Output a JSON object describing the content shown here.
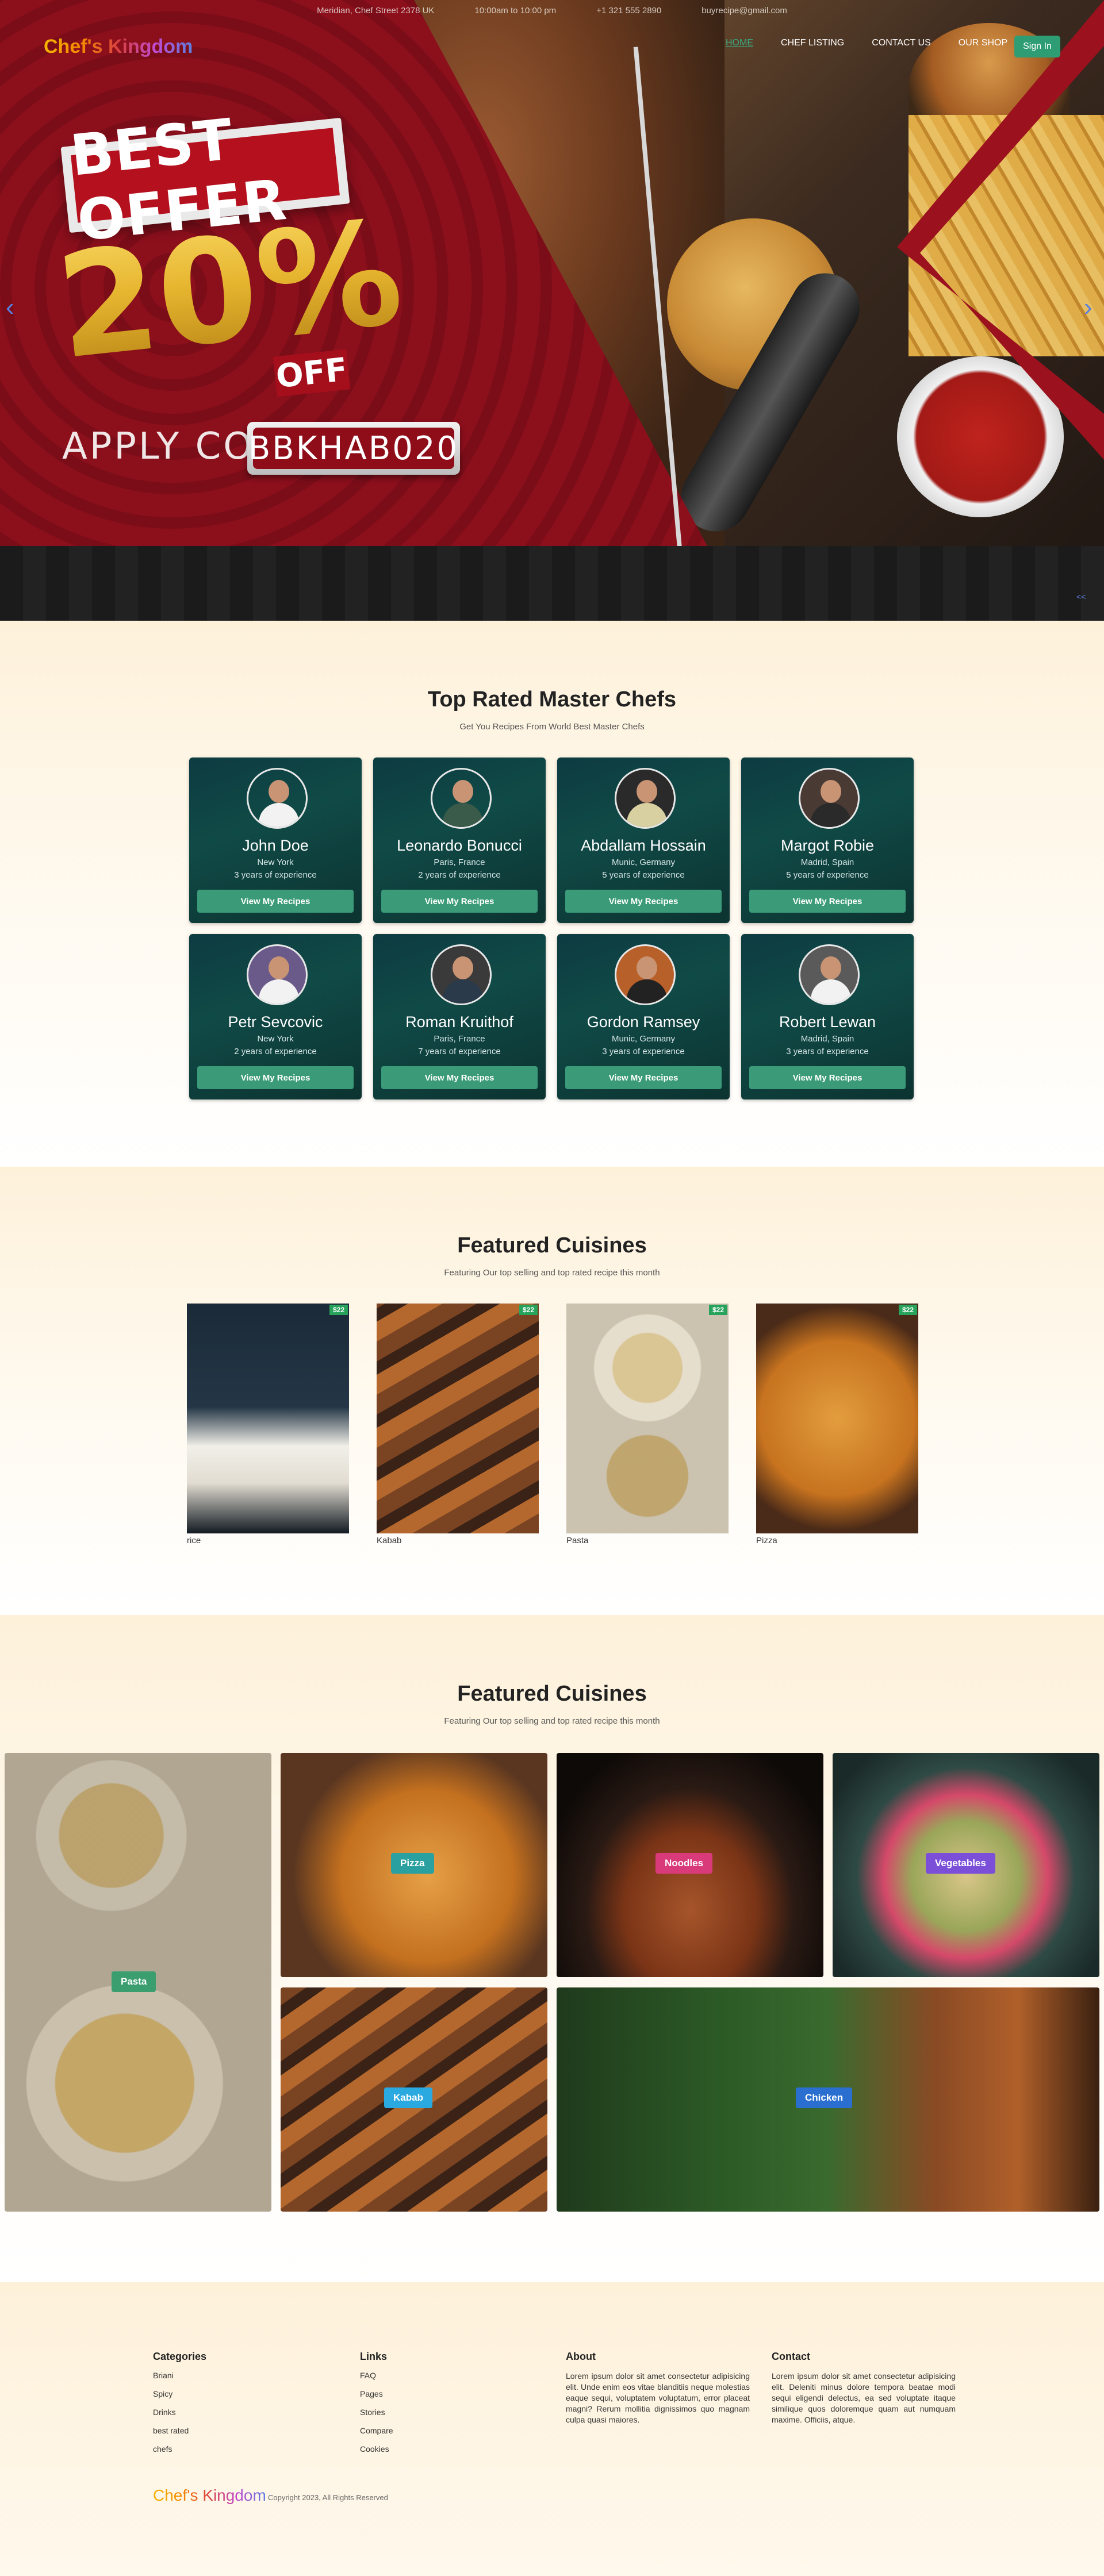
{
  "topbar": {
    "address": "Meridian, Chef Street 2378 UK",
    "hours": "10:00am to 10:00 pm",
    "phone": "+1 321 555 2890",
    "email": "buyrecipe@gmail.com"
  },
  "brand": "Chef's Kingdom",
  "nav": [
    "HOME",
    "CHEF LISTING",
    "CONTACT US",
    "OUR SHOP"
  ],
  "signin": "Sign In",
  "hero": {
    "offer_line": "BEST OFFER",
    "percent": "20%",
    "off": "OFF",
    "apply": "APPLY CODE",
    "code": "BBKHAB020",
    "arrow_left": "‹",
    "arrow_right": "›",
    "dot": "<<",
    "colors": {
      "red": "#8c0f1c",
      "gold": "#e6b52f"
    }
  },
  "chefs_section": {
    "title": "Top Rated Master Chefs",
    "subtitle": "Get You Recipes From World Best Master Chefs",
    "button_label": "View My Recipes",
    "chefs": [
      {
        "name": "John Doe",
        "location": "New York",
        "experience": "3 years of experience"
      },
      {
        "name": "Leonardo Bonucci",
        "location": "Paris, France",
        "experience": "2 years of experience"
      },
      {
        "name": "Abdallam Hossain",
        "location": "Munic, Germany",
        "experience": "5 years of experience"
      },
      {
        "name": "Margot Robie",
        "location": "Madrid, Spain",
        "experience": "5 years of experience"
      },
      {
        "name": "Petr Sevcovic",
        "location": "New York",
        "experience": "2 years of experience"
      },
      {
        "name": "Roman Kruithof",
        "location": "Paris, France",
        "experience": "7 years of experience"
      },
      {
        "name": "Gordon Ramsey",
        "location": "Munic, Germany",
        "experience": "3 years of experience"
      },
      {
        "name": "Robert Lewan",
        "location": "Madrid, Spain",
        "experience": "3 years of experience"
      }
    ]
  },
  "featured": {
    "title": "Featured Cuisines",
    "subtitle": "Featuring Our top selling and top rated recipe this month",
    "items": [
      {
        "label": "rice",
        "price": "$22"
      },
      {
        "label": "Kabab",
        "price": "$22"
      },
      {
        "label": "Pasta",
        "price": "$22"
      },
      {
        "label": "Pizza",
        "price": "$22"
      }
    ]
  },
  "gallery": {
    "title": "Featured Cuisines",
    "subtitle": "Featuring Our top selling and top rated recipe this month",
    "tags": [
      {
        "label": "Pasta",
        "color": "#3a9e6e"
      },
      {
        "label": "Pizza",
        "color": "#2aa0a0"
      },
      {
        "label": "Noodles",
        "color": "#d93a7a"
      },
      {
        "label": "Vegetables",
        "color": "#7b4fd8"
      },
      {
        "label": "Kabab",
        "color": "#2aa8e0"
      },
      {
        "label": "Chicken",
        "color": "#2a6fd0"
      }
    ]
  },
  "footer": {
    "categories": {
      "heading": "Categories",
      "links": [
        "Briani",
        "Spicy",
        "Drinks",
        "best rated",
        "chefs"
      ]
    },
    "links": {
      "heading": "Links",
      "links": [
        "FAQ",
        "Pages",
        "Stories",
        "Compare",
        "Cookies"
      ]
    },
    "about": {
      "heading": "About",
      "text": "Lorem ipsum dolor sit amet consectetur adipisicing elit. Unde enim eos vitae blanditiis neque molestias eaque sequi, voluptatem voluptatum, error placeat magni? Rerum mollitia dignissimos quo magnam culpa quasi maiores."
    },
    "contact": {
      "heading": "Contact",
      "text": "Lorem ipsum dolor sit amet consectetur adipisicing elit. Deleniti minus dolore tempora beatae modi sequi eligendi delectus, ea sed voluptate itaque similique quos doloremque quam aut numquam maxime. Officiis, atque."
    },
    "brand": "Chef's Kingdom",
    "copyright": "Copyright 2023, All Rights Reserved"
  }
}
